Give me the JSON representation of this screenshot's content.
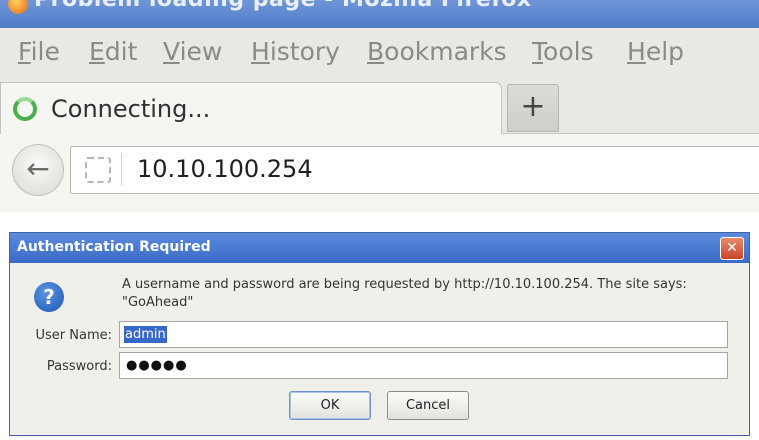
{
  "browser": {
    "window_title": "Problem loading page - Mozilla Firefox",
    "menu": [
      "File",
      "Edit",
      "View",
      "History",
      "Bookmarks",
      "Tools",
      "Help"
    ],
    "tab": {
      "label": "Connecting..."
    },
    "new_tab_label": "+",
    "back_label": "←",
    "url": "10.10.100.254"
  },
  "dialog": {
    "title": "Authentication Required",
    "close_label": "✕",
    "icon": "?",
    "message": "A username and password are being requested by http://10.10.100.254. The site says: \"GoAhead\"",
    "username_label": "User Name:",
    "username_value": "admin",
    "password_label": "Password:",
    "password_value": "●●●●●",
    "ok_label": "OK",
    "cancel_label": "Cancel"
  },
  "colors": {
    "titlebar": "#4f7cc9",
    "dialog_title": "#3a6ac6",
    "selection": "#3769c8"
  }
}
